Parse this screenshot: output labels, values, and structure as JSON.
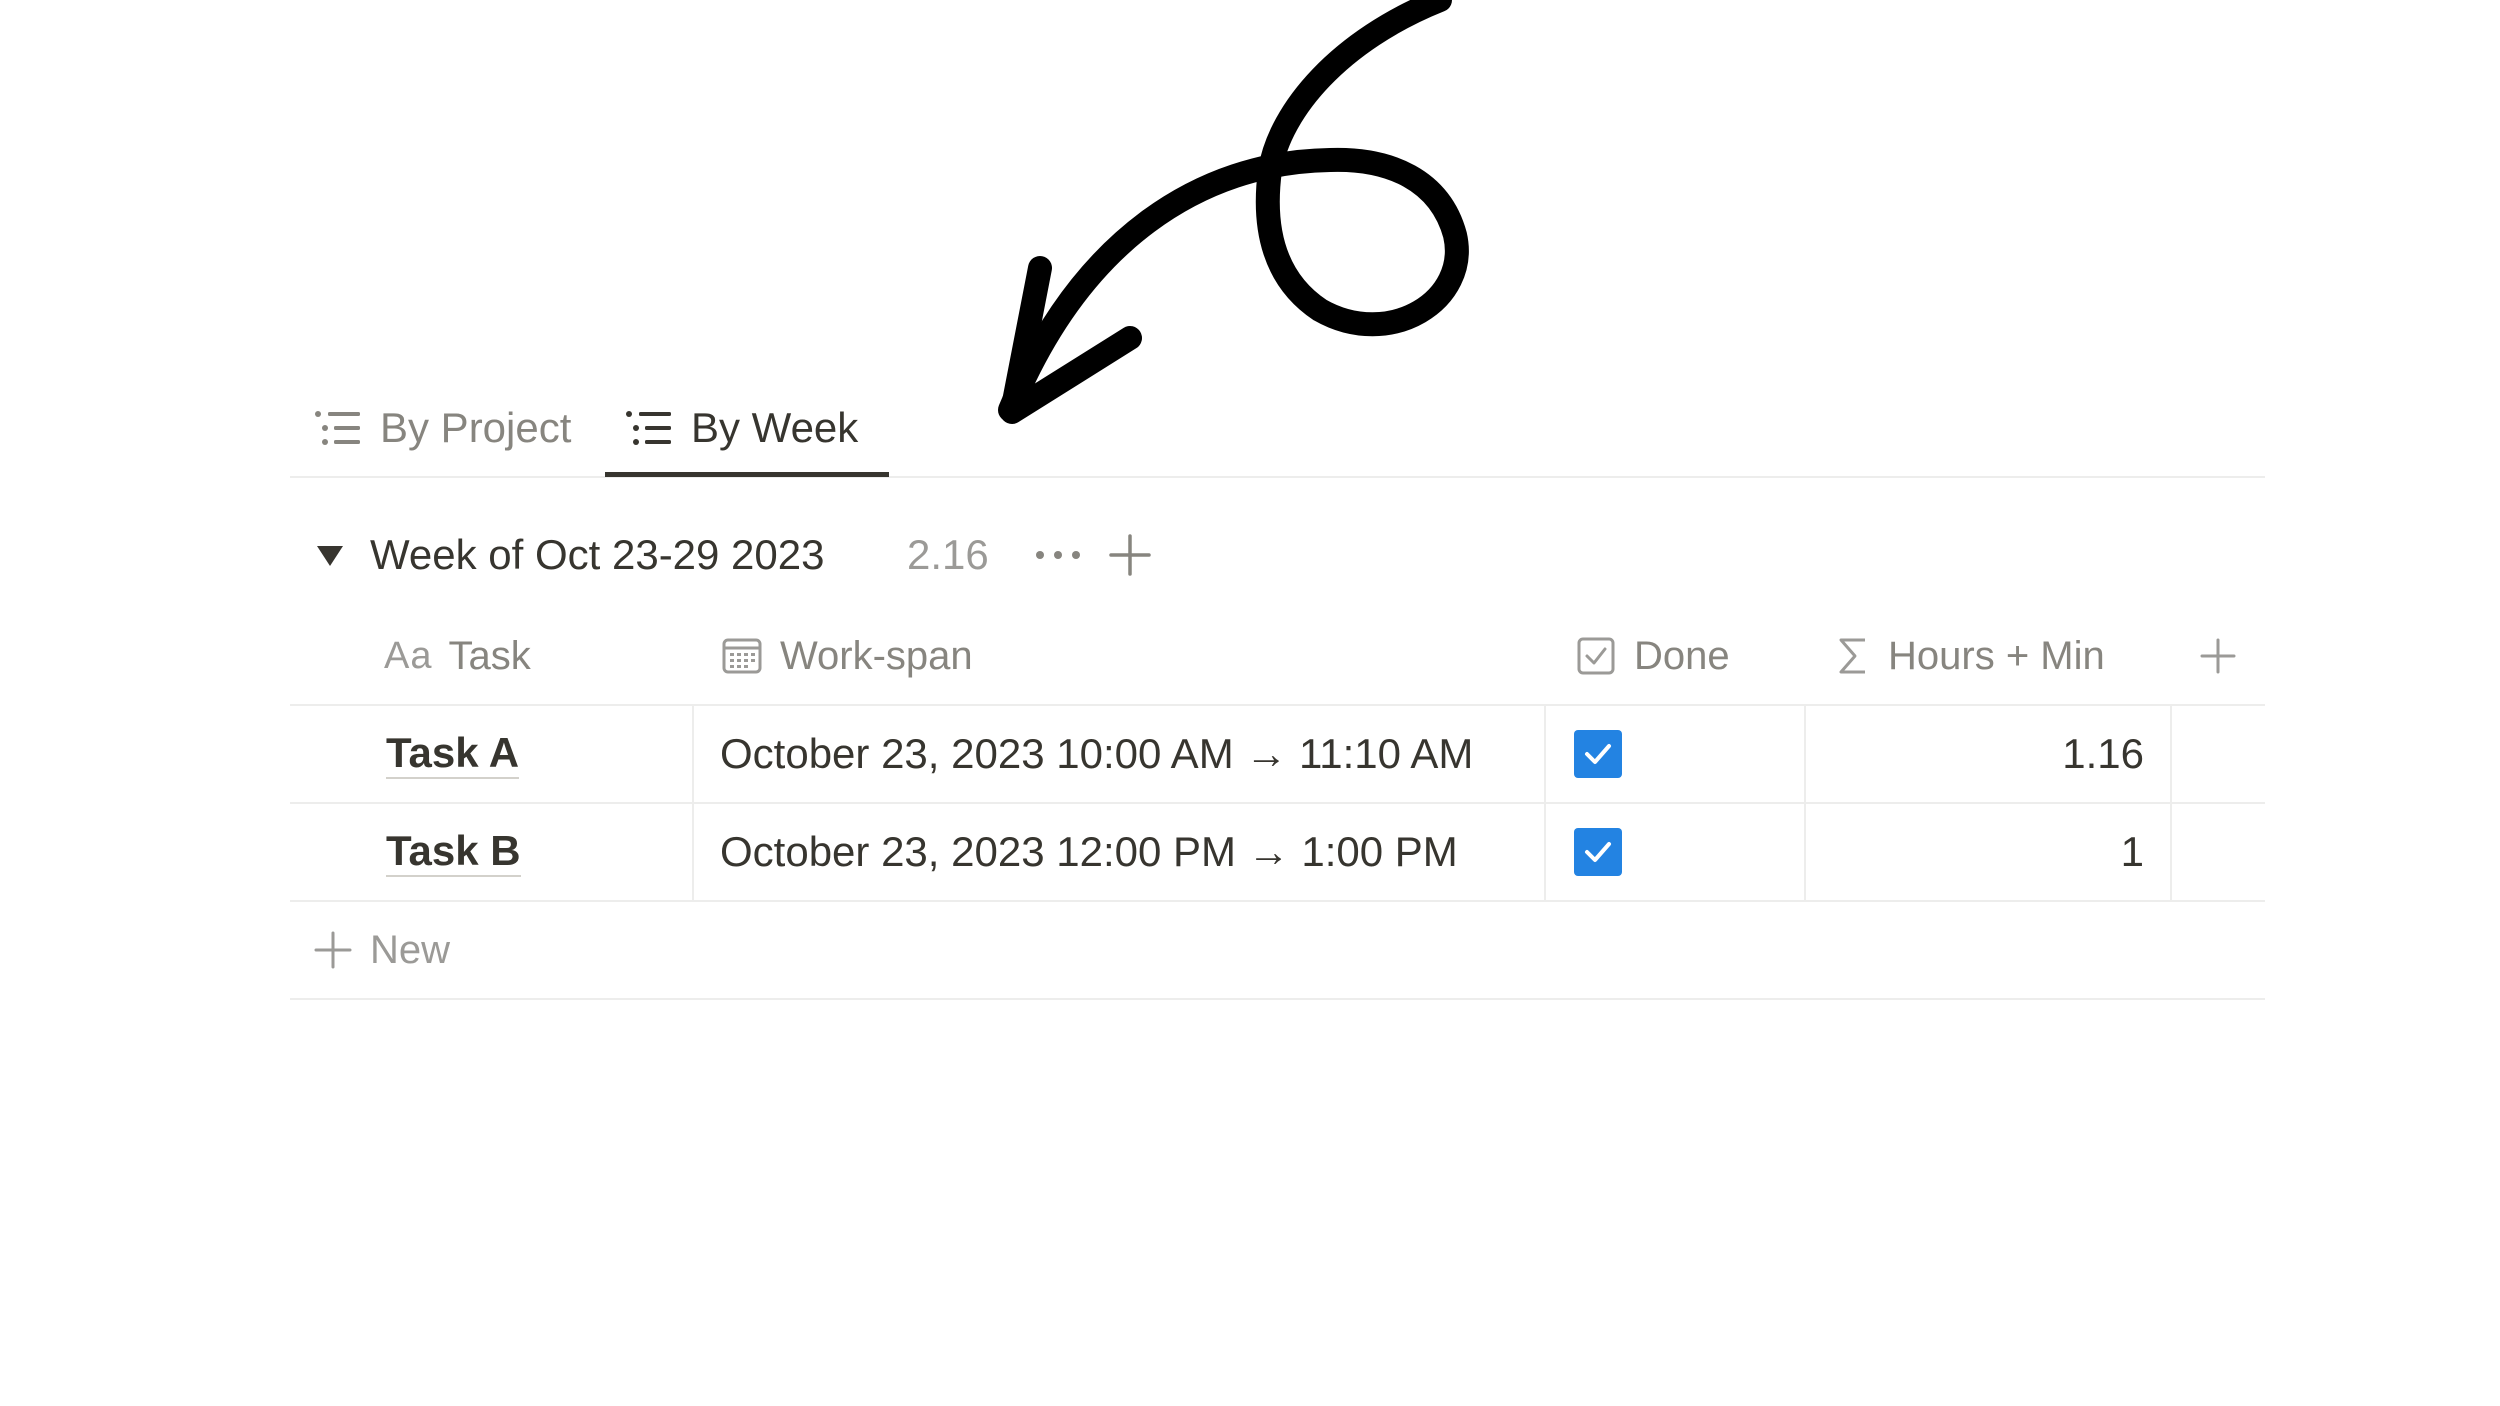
{
  "tabs": [
    {
      "label": "By Project",
      "icon": "list-icon",
      "active": false
    },
    {
      "label": "By Week",
      "icon": "list-icon",
      "active": true
    }
  ],
  "group": {
    "title": "Week of Oct 23-29 2023",
    "sum": "2.16"
  },
  "columns": {
    "task": {
      "prefix": "Aa",
      "label": "Task"
    },
    "span": {
      "label": "Work-span",
      "icon": "calendar-icon"
    },
    "done": {
      "label": "Done",
      "icon": "checkbox-icon"
    },
    "hours": {
      "label": "Hours + Min",
      "icon": "sigma-icon"
    }
  },
  "rows": [
    {
      "task": "Task A",
      "span": "October 23, 2023 10:00 AM → 11:10 AM",
      "done": true,
      "hours": "1.16"
    },
    {
      "task": "Task B",
      "span": "October 23, 2023 12:00 PM → 1:00 PM",
      "done": true,
      "hours": "1"
    }
  ],
  "new_label": "New",
  "colors": {
    "accent": "#2383e2",
    "text": "#37352f",
    "muted": "#9b9a97",
    "border": "#ededec"
  }
}
